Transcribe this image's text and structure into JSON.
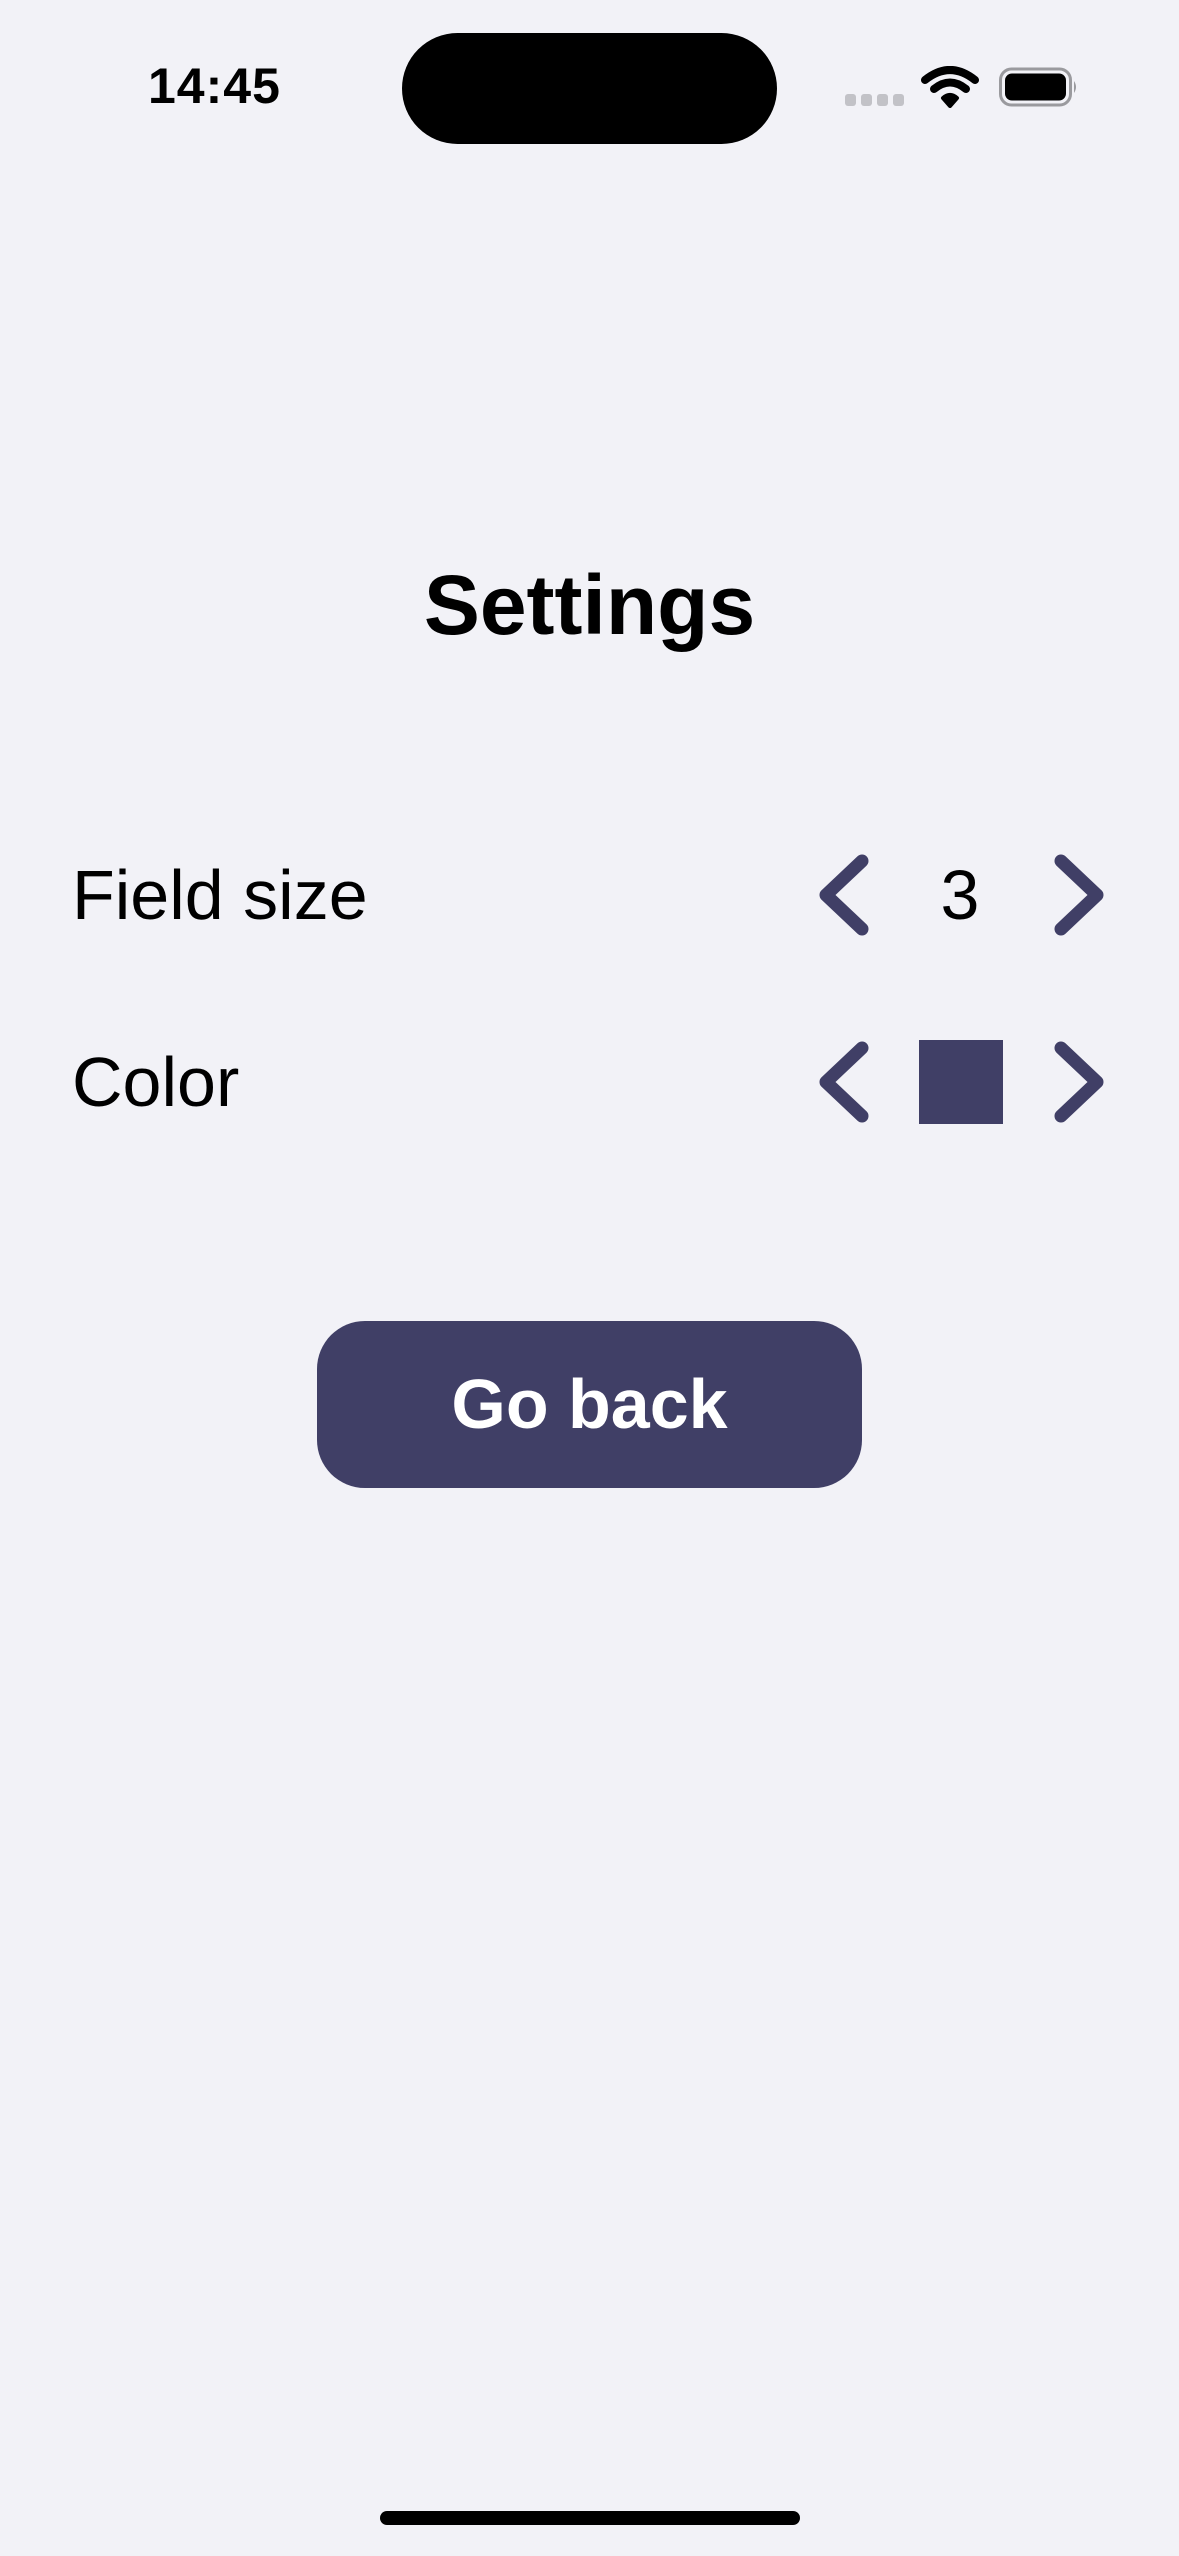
{
  "status_bar": {
    "time": "14:45",
    "icons": [
      "signal-icon",
      "wifi-icon",
      "battery-icon"
    ]
  },
  "screen": {
    "title": "Settings"
  },
  "settings": {
    "field_size": {
      "label": "Field size",
      "value": "3",
      "prev_icon": "chevron-left-icon",
      "next_icon": "chevron-right-icon"
    },
    "color": {
      "label": "Color",
      "value": "#403f66",
      "prev_icon": "chevron-left-icon",
      "next_icon": "chevron-right-icon"
    }
  },
  "actions": {
    "go_back_label": "Go back"
  },
  "theme": {
    "background": "#f2f2f7",
    "accent": "#403f66",
    "text": "#000000"
  }
}
